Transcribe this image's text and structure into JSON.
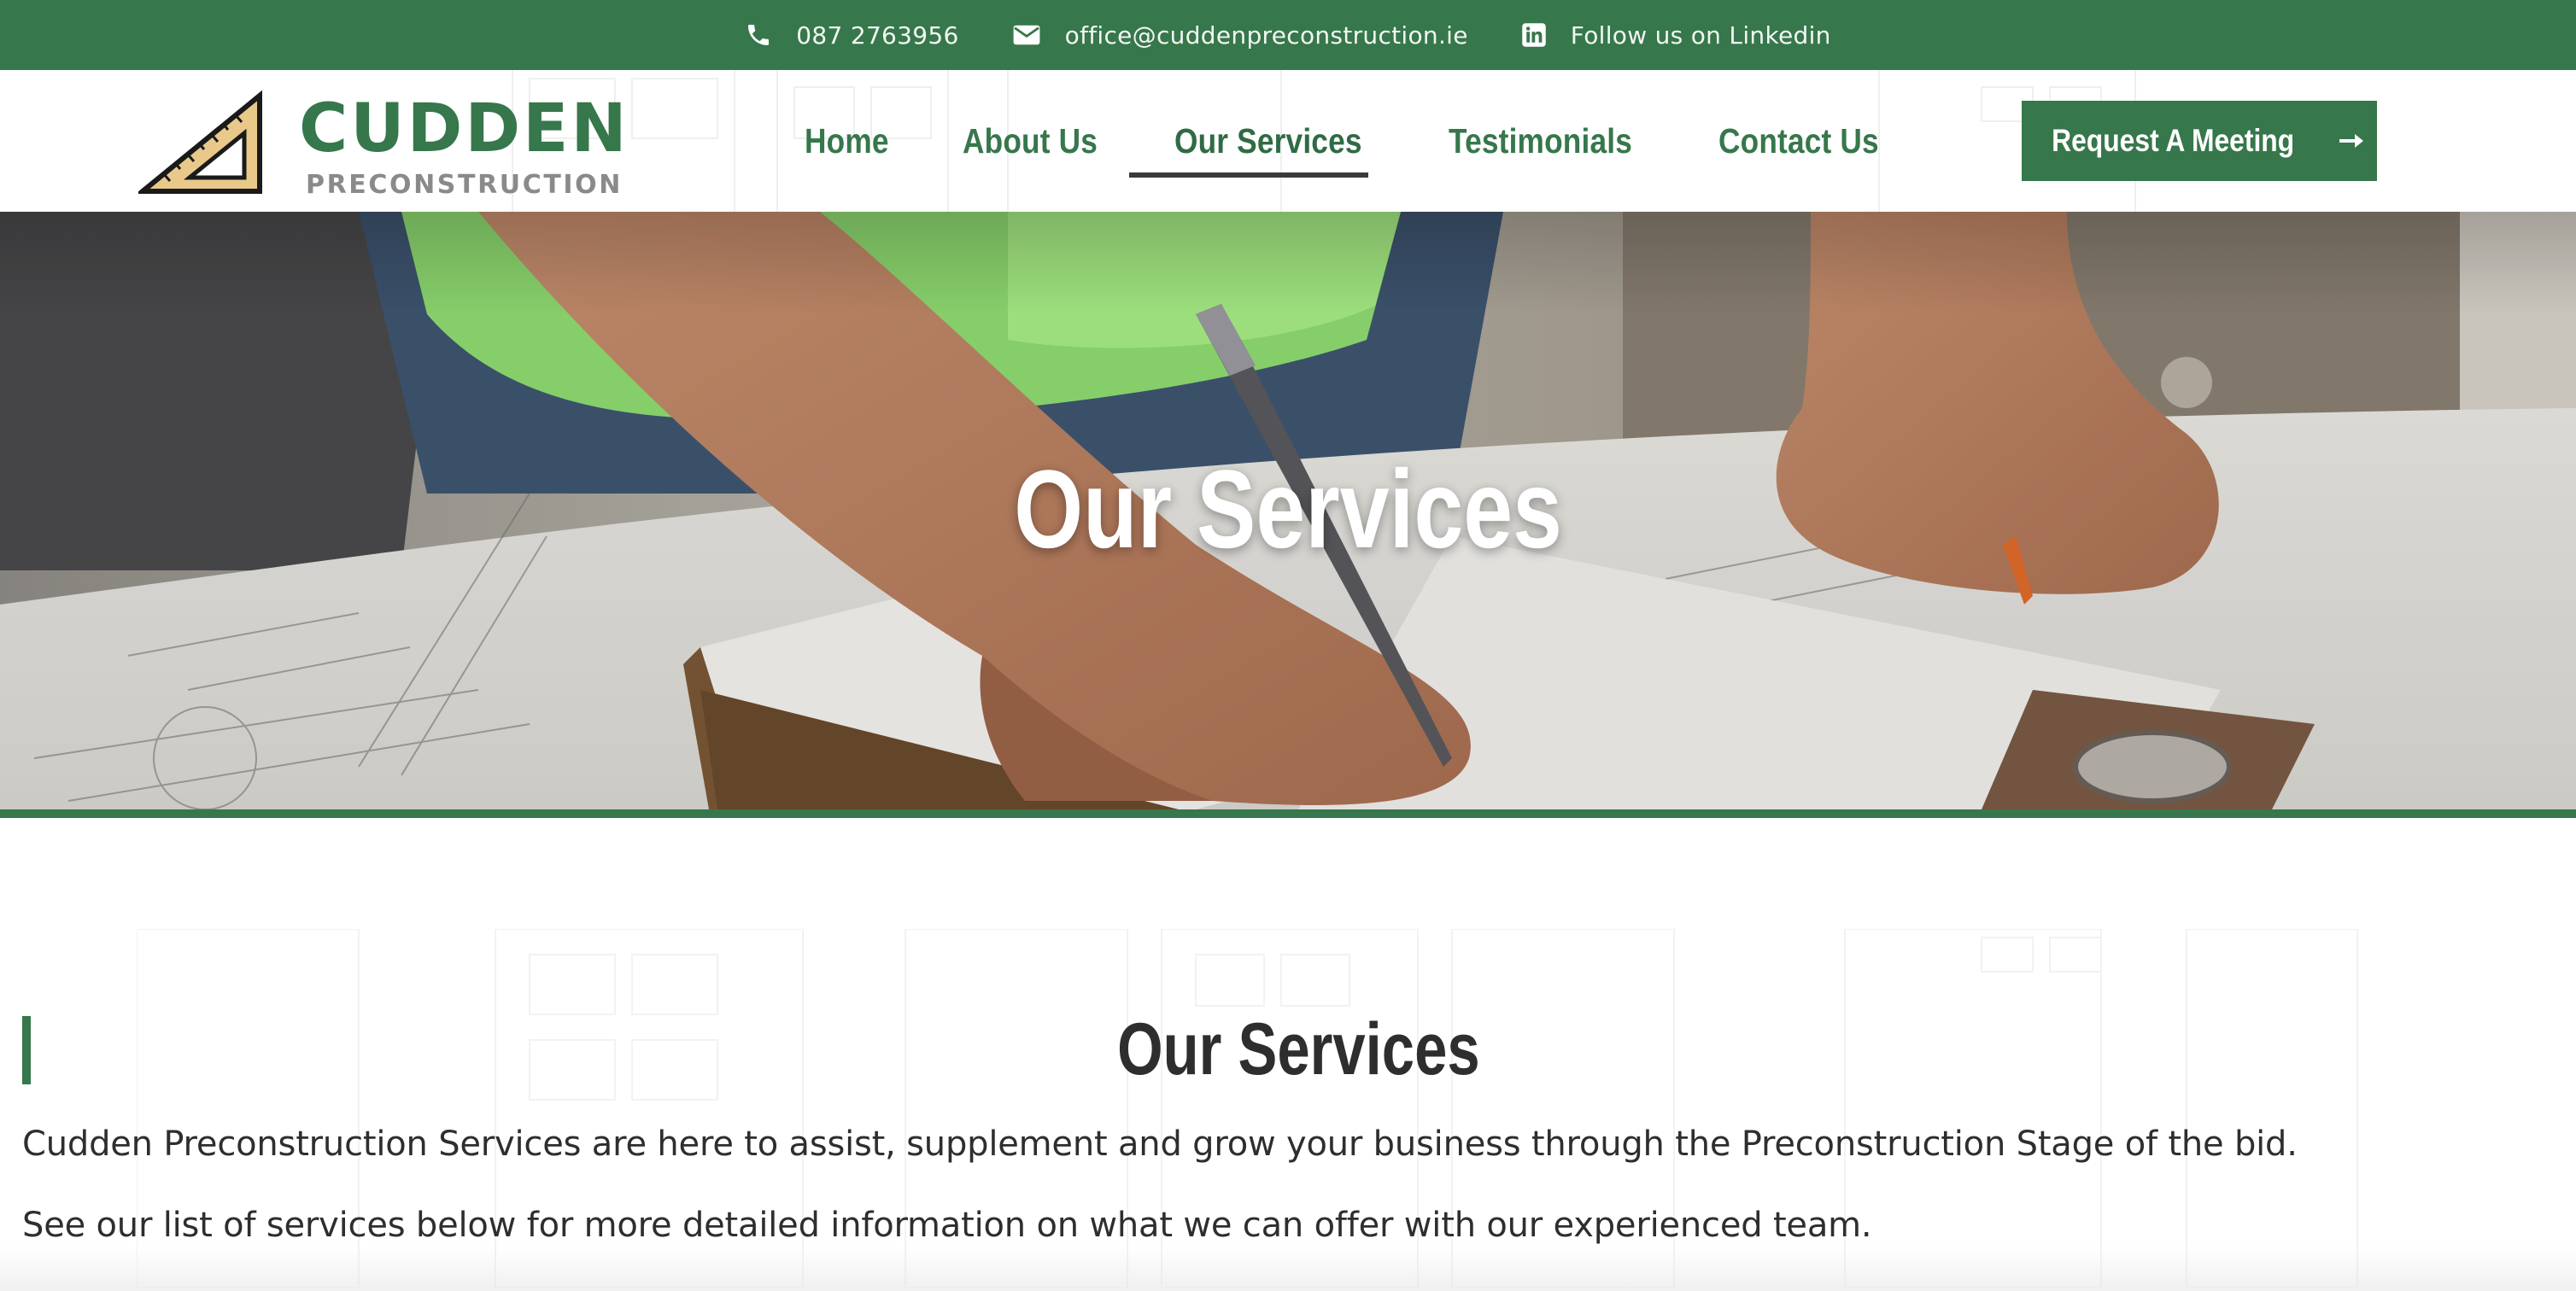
{
  "topbar": {
    "phone": "087 2763956",
    "email": "office@cuddenpreconstruction.ie",
    "linkedin": "Follow us on Linkedin",
    "icons": [
      "phone-icon",
      "envelope-icon",
      "linkedin-icon"
    ]
  },
  "logo": {
    "name": "CUDDEN",
    "tagline": "PRECONSTRUCTION"
  },
  "nav": {
    "items": [
      {
        "label": "Home"
      },
      {
        "label": "About Us"
      },
      {
        "label": "Our Services",
        "active": true
      },
      {
        "label": "Testimonials"
      },
      {
        "label": "Contact Us"
      }
    ]
  },
  "cta": {
    "label": "Request A Meeting",
    "icon": "arrow-right-icon"
  },
  "hero": {
    "title": "Our Services"
  },
  "content": {
    "title": "Our Services",
    "paragraphs": [
      "Cudden Preconstruction Services are here to assist, supplement and grow your business through the Preconstruction Stage of the bid.",
      "See our list of services below for more detailed information on what we can offer with our experienced team."
    ]
  },
  "colors": {
    "brand_green": "#36774b",
    "text_dark": "#2e2e2e",
    "logo_gray": "#8a8a8a",
    "logo_triangle": "#e8c98a"
  }
}
